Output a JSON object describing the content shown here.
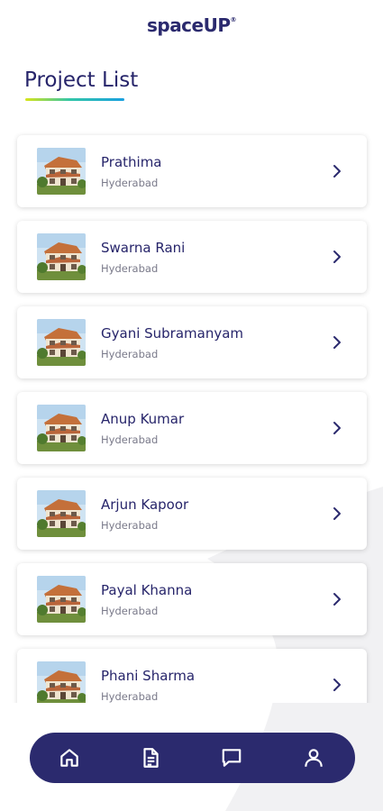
{
  "app": {
    "logo": "spaceUP",
    "logo_mark": "®"
  },
  "page": {
    "title": "Project List"
  },
  "projects": [
    {
      "name": "Prathima",
      "city": "Hyderabad"
    },
    {
      "name": "Swarna Rani",
      "city": "Hyderabad"
    },
    {
      "name": "Gyani Subramanyam",
      "city": "Hyderabad"
    },
    {
      "name": "Anup Kumar",
      "city": "Hyderabad"
    },
    {
      "name": "Arjun Kapoor",
      "city": "Hyderabad"
    },
    {
      "name": "Payal Khanna",
      "city": "Hyderabad"
    },
    {
      "name": "Phani Sharma",
      "city": "Hyderabad"
    }
  ],
  "nav": {
    "items": [
      {
        "icon": "home-icon"
      },
      {
        "icon": "document-icon"
      },
      {
        "icon": "chat-icon"
      },
      {
        "icon": "profile-icon"
      }
    ]
  },
  "colors": {
    "primary": "#2b2a6e",
    "text_secondary": "#7a7a8a",
    "underline_start": "#d8e51a",
    "underline_end": "#1aa0e0"
  }
}
